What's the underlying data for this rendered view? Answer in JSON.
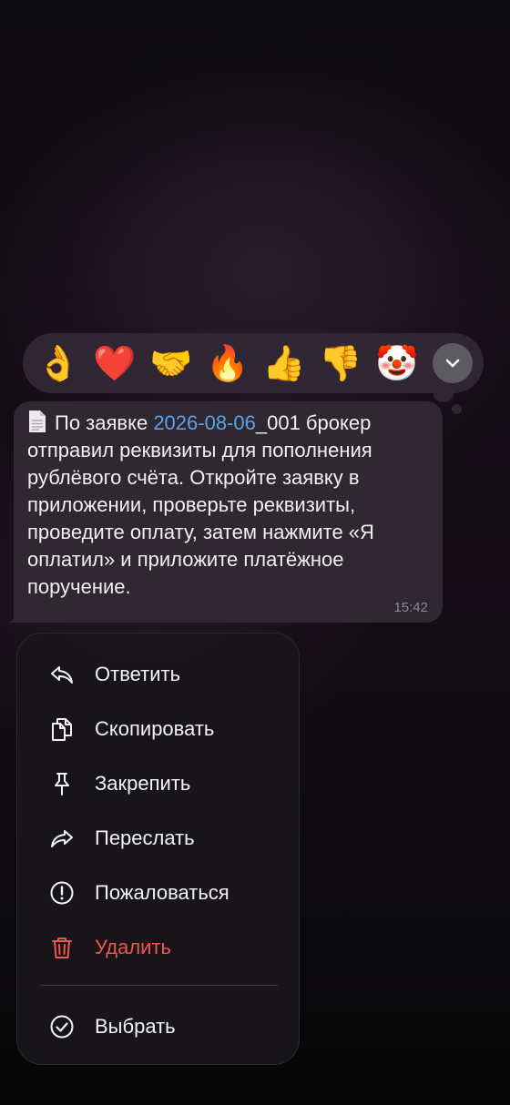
{
  "reactions": [
    {
      "emoji": "👌",
      "name": "ok-hand"
    },
    {
      "emoji": "❤️",
      "name": "heart"
    },
    {
      "emoji": "🤝",
      "name": "handshake"
    },
    {
      "emoji": "🔥",
      "name": "fire"
    },
    {
      "emoji": "👍",
      "name": "thumbs-up"
    },
    {
      "emoji": "👎",
      "name": "thumbs-down"
    },
    {
      "emoji": "🤡",
      "name": "clown"
    }
  ],
  "message": {
    "text_before_link": "По заявке ",
    "link": "2026-08-06",
    "text_after_link": "_001 брокер отправил реквизиты для пополнения рублёвого счёта. Откройте заявку в приложении, проверьте реквизиты, проведите оплату, затем нажмите «Я оплатил» и приложите платёжное поручение.",
    "time": "15:42"
  },
  "menu": {
    "items": [
      {
        "label": "Ответить",
        "icon": "reply-icon"
      },
      {
        "label": "Скопировать",
        "icon": "copy-icon"
      },
      {
        "label": "Закрепить",
        "icon": "pin-icon"
      },
      {
        "label": "Переслать",
        "icon": "forward-icon"
      },
      {
        "label": "Пожаловаться",
        "icon": "report-icon"
      },
      {
        "label": "Удалить",
        "icon": "trash-icon",
        "danger": true
      }
    ],
    "select": {
      "label": "Выбрать",
      "icon": "check-circle-icon"
    }
  },
  "colors": {
    "link": "#5aa2f0",
    "danger": "#f0554d",
    "bubble": "#2f2831",
    "menu_bg": "#18161b"
  }
}
